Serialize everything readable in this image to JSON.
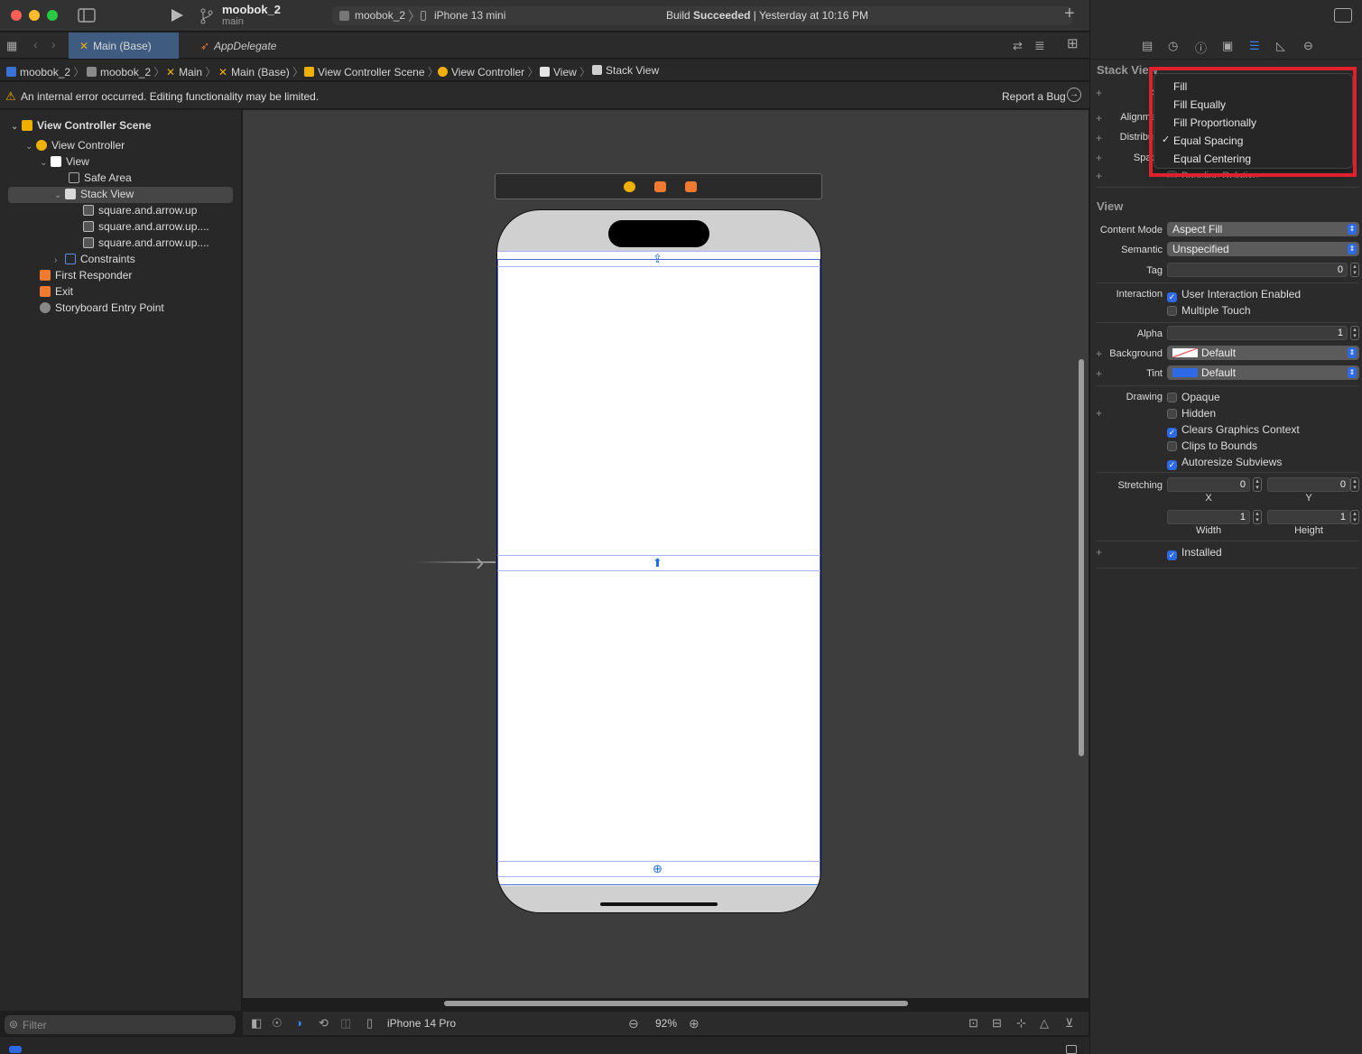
{
  "toolbar": {
    "project_name": "moobok_2",
    "branch": "main",
    "scheme": "moobok_2",
    "device": "iPhone 13 mini",
    "build_status_prefix": "Build ",
    "build_status_bold": "Succeeded",
    "build_status_suffix": " | Yesterday at 10:16 PM",
    "add_label": "+"
  },
  "tabs": [
    {
      "label": "Main (Base)"
    },
    {
      "label": "AppDelegate"
    }
  ],
  "jumpbar": [
    "moobok_2",
    "moobok_2",
    "Main",
    "Main (Base)",
    "View Controller Scene",
    "View Controller",
    "View",
    "Stack View"
  ],
  "warning": {
    "text": "An internal error occurred. Editing functionality may be limited.",
    "action": "Report a Bug"
  },
  "outline": [
    {
      "label": "View Controller Scene"
    },
    {
      "label": "View Controller"
    },
    {
      "label": "View"
    },
    {
      "label": "Safe Area"
    },
    {
      "label": "Stack View"
    },
    {
      "label": "square.and.arrow.up"
    },
    {
      "label": "square.and.arrow.up...."
    },
    {
      "label": "square.and.arrow.up...."
    },
    {
      "label": "Constraints"
    },
    {
      "label": "First Responder"
    },
    {
      "label": "Exit"
    },
    {
      "label": "Storyboard Entry Point"
    }
  ],
  "filter": {
    "placeholder": "Filter"
  },
  "bottom_bar": {
    "device": "iPhone 14 Pro",
    "zoom": "92%"
  },
  "inspector": {
    "stack_view_header": "Stack View",
    "axis_label": "A",
    "alignment_label": "Alignme",
    "distribution_label": "Distribut",
    "spacing_label": "Spac",
    "baseline_text": "Baseline Relative",
    "view_header": "View",
    "content_mode_label": "Content Mode",
    "content_mode_value": "Aspect Fill",
    "semantic_label": "Semantic",
    "semantic_value": "Unspecified",
    "tag_label": "Tag",
    "tag_value": "0",
    "interaction_label": "Interaction",
    "user_interaction": "User Interaction Enabled",
    "multiple_touch": "Multiple Touch",
    "alpha_label": "Alpha",
    "alpha_value": "1",
    "background_label": "Background",
    "background_value": "Default",
    "tint_label": "Tint",
    "tint_value": "Default",
    "drawing_label": "Drawing",
    "opaque": "Opaque",
    "hidden": "Hidden",
    "clears_graphics": "Clears Graphics Context",
    "clips_to_bounds": "Clips to Bounds",
    "autoresize": "Autoresize Subviews",
    "stretching_label": "Stretching",
    "stretch_x_value": "0",
    "stretch_y_value": "0",
    "x_label": "X",
    "y_label": "Y",
    "stretch_w_value": "1",
    "stretch_h_value": "1",
    "width_label": "Width",
    "height_label": "Height",
    "installed": "Installed"
  },
  "distribution_menu": {
    "items": [
      {
        "label": "Fill"
      },
      {
        "label": "Fill Equally"
      },
      {
        "label": "Fill Proportionally"
      },
      {
        "label": "Equal Spacing"
      },
      {
        "label": "Equal Centering"
      }
    ],
    "selected_index": 3,
    "highlight_color": "#e0202c"
  },
  "colors": {
    "accent": "#2f6ae6",
    "tab_selected": "#3f5c80",
    "warning": "#f0b000"
  }
}
